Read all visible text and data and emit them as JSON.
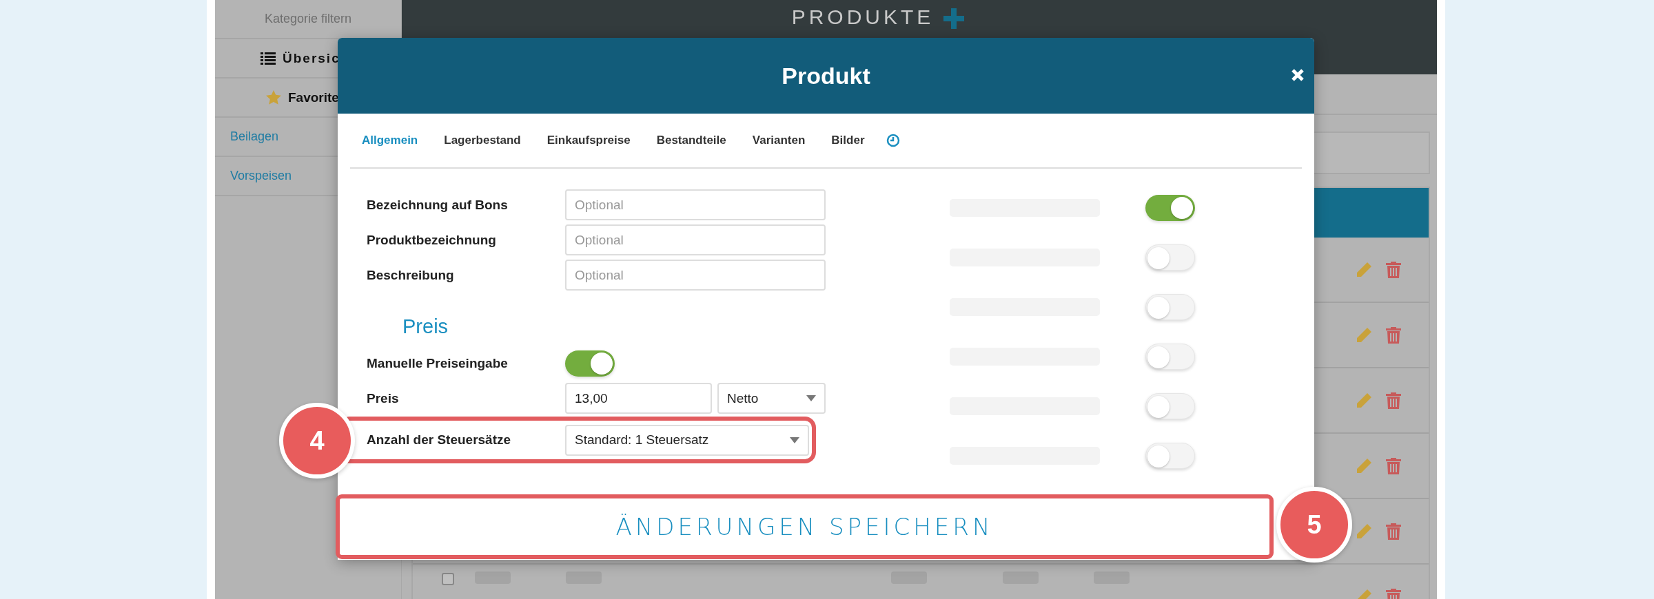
{
  "sidebar": {
    "filter_label": "Kategorie filtern",
    "views": [
      {
        "label": "Übersic",
        "kind": "list"
      },
      {
        "label": "Favorite",
        "kind": "star"
      }
    ],
    "categories": [
      "Beilagen",
      "Vorspeisen"
    ]
  },
  "page_title": "PRODUKTE",
  "table": {
    "visible_row_checked": false
  },
  "modal": {
    "title": "Produkt",
    "tabs": [
      {
        "label": "Allgemein",
        "selected": true
      },
      {
        "label": "Lagerbestand",
        "selected": false
      },
      {
        "label": "Einkaufspreise",
        "selected": false
      },
      {
        "label": "Bestandteile",
        "selected": false
      },
      {
        "label": "Varianten",
        "selected": false
      },
      {
        "label": "Bilder",
        "selected": false
      }
    ],
    "fields": [
      {
        "label": "Bezeichnung auf Bons",
        "placeholder": "Optional"
      },
      {
        "label": "Produktbezeichnung",
        "placeholder": "Optional"
      },
      {
        "label": "Beschreibung",
        "placeholder": "Optional"
      }
    ],
    "section_title": "Preis",
    "manual_price": {
      "label": "Manuelle Preiseingabe",
      "on": true
    },
    "price": {
      "label": "Preis",
      "value": "13,00",
      "mode": "Netto"
    },
    "tax": {
      "label": "Anzahl der Steuersätze",
      "value": "Standard: 1 Steuersatz",
      "highlighted": true
    },
    "options": [
      {
        "on": true
      },
      {
        "on": false
      },
      {
        "on": false
      },
      {
        "on": false
      },
      {
        "on": false
      },
      {
        "on": false
      }
    ],
    "save_button": {
      "label": "ÄNDERUNGEN SPEICHERN",
      "highlighted": true
    }
  },
  "callouts": [
    {
      "number": "4"
    },
    {
      "number": "5"
    }
  ]
}
